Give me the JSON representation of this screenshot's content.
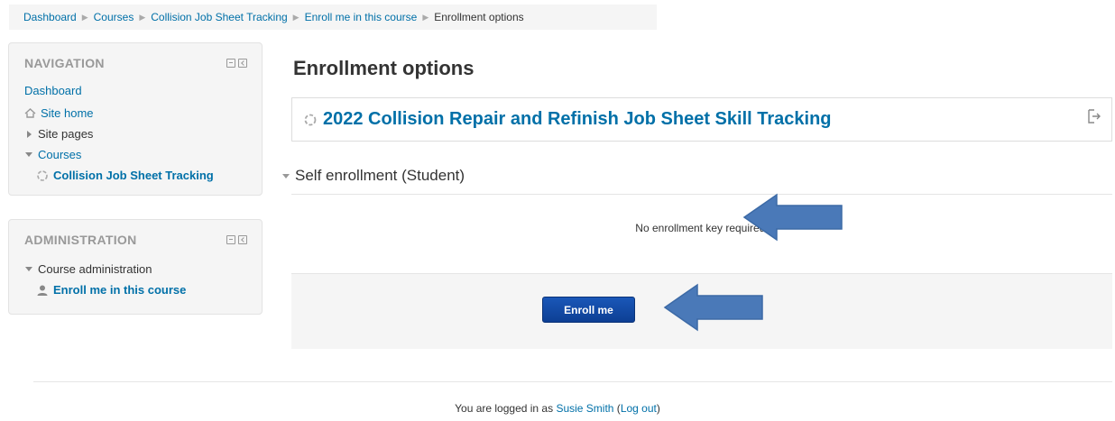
{
  "breadcrumb": {
    "items": [
      "Dashboard",
      "Courses",
      "Collision Job Sheet Tracking",
      "Enroll me in this course"
    ],
    "current": "Enrollment options"
  },
  "navigation": {
    "title": "NAVIGATION",
    "dashboard": "Dashboard",
    "site_home": "Site home",
    "site_pages": "Site pages",
    "courses": "Courses",
    "course_link": "Collision Job Sheet Tracking"
  },
  "administration": {
    "title": "ADMINISTRATION",
    "course_admin": "Course administration",
    "enrol_link": "Enroll me in this course"
  },
  "main": {
    "page_title": "Enrollment options",
    "course_name": "2022 Collision Repair and Refinish Job Sheet Skill Tracking",
    "section_title": "Self enrollment (Student)",
    "info": "No enrollment key required.",
    "enrol_button": "Enroll me"
  },
  "footer": {
    "prefix": "You are logged in as ",
    "user": "Susie Smith",
    "open_paren": " (",
    "logout": "Log out",
    "close_paren": ")"
  },
  "colors": {
    "link": "#0070a8",
    "button": "#123f98",
    "annotation_arrow": "#4a79b8"
  }
}
